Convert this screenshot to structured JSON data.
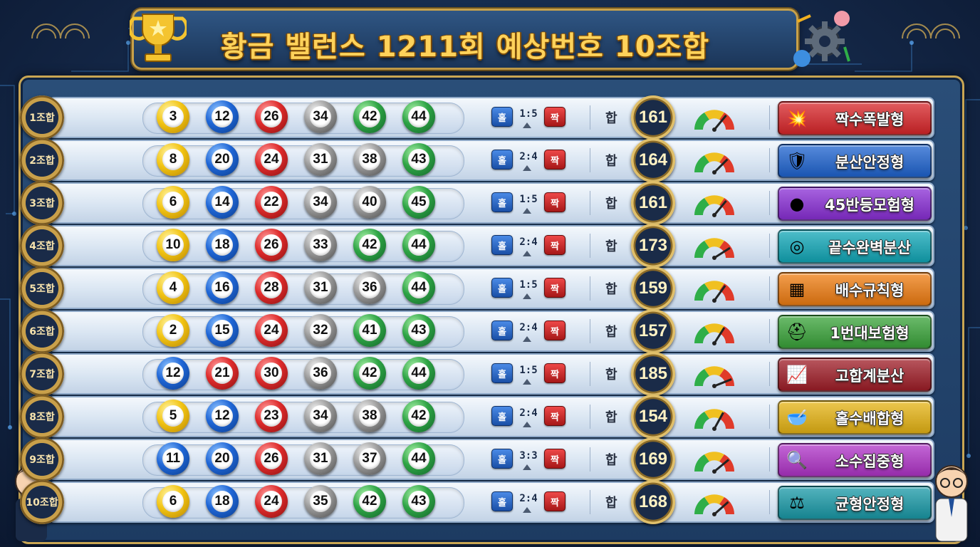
{
  "header": {
    "title": "황금 밸런스 1211회 예상번호 10조합"
  },
  "labels": {
    "odd": "홀",
    "even": "짝",
    "sum": "합"
  },
  "colors": {
    "gold": "#ffd25a",
    "board": "#1d3b62",
    "yellow": "#f2c414",
    "blue": "#1f66d6",
    "red": "#de2b2b",
    "gray": "#9a9a9a",
    "green": "#2ea445"
  },
  "rows": [
    {
      "combo": "1조합",
      "numbers": [
        "3",
        "12",
        "26",
        "34",
        "42",
        "44"
      ],
      "ratio": "1:5",
      "sum": "161",
      "type": "짝수폭발형",
      "type_icon": "explosion-icon",
      "type_color": "#d9262a"
    },
    {
      "combo": "2조합",
      "numbers": [
        "8",
        "20",
        "24",
        "31",
        "38",
        "43"
      ],
      "ratio": "2:4",
      "sum": "164",
      "type": "분산안정형",
      "type_icon": "shield-icon",
      "type_color": "#1f64d0"
    },
    {
      "combo": "3조합",
      "numbers": [
        "6",
        "14",
        "22",
        "34",
        "40",
        "45"
      ],
      "ratio": "1:5",
      "sum": "161",
      "type": "45반등모험형",
      "type_icon": "bounce-icon",
      "type_color": "#8a2fd6"
    },
    {
      "combo": "4조합",
      "numbers": [
        "10",
        "18",
        "26",
        "33",
        "42",
        "44"
      ],
      "ratio": "2:4",
      "sum": "173",
      "type": "끝수완벽분산",
      "type_icon": "target-icon",
      "type_color": "#12a8b8"
    },
    {
      "combo": "5조합",
      "numbers": [
        "4",
        "16",
        "28",
        "31",
        "36",
        "44"
      ],
      "ratio": "1:5",
      "sum": "159",
      "type": "배수규칙형",
      "type_icon": "calculator-icon",
      "type_color": "#ef7d12"
    },
    {
      "combo": "6조합",
      "numbers": [
        "2",
        "15",
        "24",
        "32",
        "41",
        "43"
      ],
      "ratio": "2:4",
      "sum": "157",
      "type": "1번대보험형",
      "type_icon": "helmet-icon",
      "type_color": "#3aa43a"
    },
    {
      "combo": "7조합",
      "numbers": [
        "12",
        "21",
        "30",
        "36",
        "42",
        "44"
      ],
      "ratio": "1:5",
      "sum": "185",
      "type": "고합계분산",
      "type_icon": "chart-up-icon",
      "type_color": "#a01e28"
    },
    {
      "combo": "8조합",
      "numbers": [
        "5",
        "12",
        "23",
        "34",
        "38",
        "42"
      ],
      "ratio": "2:4",
      "sum": "154",
      "type": "홀수배합형",
      "type_icon": "mixing-bowl-icon",
      "type_color": "#e6b414"
    },
    {
      "combo": "9조합",
      "numbers": [
        "11",
        "20",
        "26",
        "31",
        "37",
        "44"
      ],
      "ratio": "3:3",
      "sum": "169",
      "type": "소수집중형",
      "type_icon": "magnifier-icon",
      "type_color": "#b034c8"
    },
    {
      "combo": "10조합",
      "numbers": [
        "6",
        "18",
        "24",
        "35",
        "42",
        "43"
      ],
      "ratio": "2:4",
      "sum": "168",
      "type": "균형안정형",
      "type_icon": "balance-scale-icon",
      "type_color": "#1a9aa8"
    }
  ]
}
